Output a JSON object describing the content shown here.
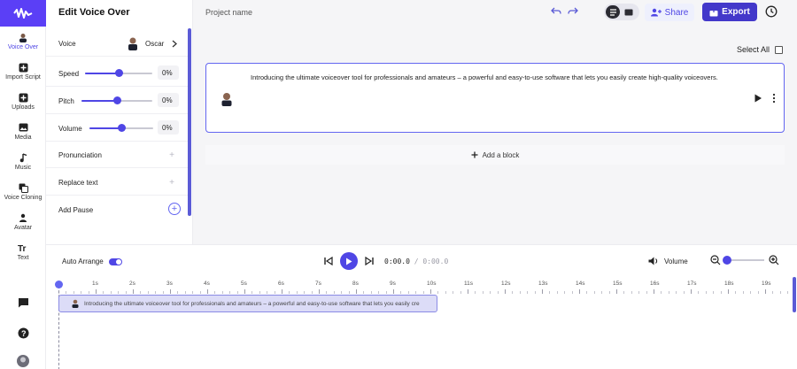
{
  "app": {
    "panel_title": "Edit Voice Over",
    "project_name": "Project name"
  },
  "sidebar": {
    "items": [
      {
        "label": "Voice Over",
        "icon": "voice-over-avatar-icon"
      },
      {
        "label": "Import Script",
        "icon": "plus-square-icon"
      },
      {
        "label": "Uploads",
        "icon": "plus-square-icon"
      },
      {
        "label": "Media",
        "icon": "image-icon"
      },
      {
        "label": "Music",
        "icon": "music-note-icon"
      },
      {
        "label": "Voice Cloning",
        "icon": "voice-cloning-icon"
      },
      {
        "label": "Avatar",
        "icon": "person-icon"
      },
      {
        "label": "Text",
        "icon": "text-icon"
      }
    ]
  },
  "panel": {
    "voice_label": "Voice",
    "voice_name": "Oscar",
    "speed_label": "Speed",
    "speed_value": "0%",
    "pitch_label": "Pitch",
    "pitch_value": "0%",
    "volume_label": "Volume",
    "volume_value": "0%",
    "pronunciation_label": "Pronunciation",
    "replace_text_label": "Replace text",
    "add_pause_label": "Add Pause",
    "slider_levels": {
      "speed": 0.5,
      "pitch": 0.5,
      "volume": 0.5
    }
  },
  "topbar": {
    "share_label": "Share",
    "export_label": "Export"
  },
  "script": {
    "select_all_label": "Select All",
    "block_text": "Introducing the ultimate voiceover tool for professionals and amateurs – a powerful and easy-to-use software that lets you easily create high-quality voiceovers.",
    "add_block_label": "Add a block"
  },
  "timeline": {
    "auto_arrange_label": "Auto Arrange",
    "time_current": "0:00.0",
    "time_total": "0:00.0",
    "time_sep": " / ",
    "volume_label": "Volume",
    "zoom_level": 0.1,
    "ticks": [
      "1s",
      "2s",
      "3s",
      "4s",
      "5s",
      "6s",
      "7s",
      "8s",
      "9s",
      "10s",
      "11s",
      "12s",
      "13s",
      "14s",
      "15s",
      "16s",
      "17s",
      "18s",
      "19s"
    ],
    "clip_text": "Introducing the ultimate voiceover tool for professionals and amateurs – a powerful and easy-to-use software that lets you easily cre"
  },
  "colors": {
    "accent": "#4f46e5",
    "export_bg": "#4338ca",
    "logo_bg": "#5b3ff6"
  }
}
